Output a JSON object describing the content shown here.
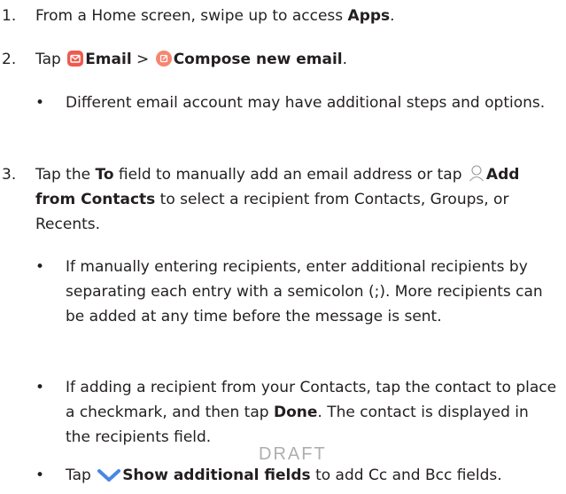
{
  "steps": [
    {
      "number": "1.",
      "pre": "From a Home screen, swipe up to access ",
      "bold": "Apps",
      "post": "."
    },
    {
      "number": "2.",
      "pre": "Tap ",
      "email_label": "Email",
      "separator": " > ",
      "compose_label": "Compose new email",
      "post": ".",
      "bullets": [
        "Different email account may have additional steps and options."
      ]
    },
    {
      "number": "3.",
      "pre": "Tap the ",
      "to_label": "To",
      "mid": " field to manually add an email address or tap ",
      "contacts_label": "Add from Contacts",
      "post": " to select a recipient from Contacts, Groups, or Recents.",
      "bullet1": "If manually entering recipients, enter additional recipients by separating each entry with a semicolon (;). More recipients can be added at any time before the message is sent.",
      "bullet2_pre": "If adding a recipient from your Contacts, tap the contact to place a checkmark, and then tap ",
      "bullet2_bold": "Done",
      "bullet2_post": ". The contact is displayed in the recipients field.",
      "bullet3_pre": "Tap ",
      "bullet3_bold": "Show additional fields",
      "bullet3_post": " to add Cc and Bcc fields."
    }
  ],
  "bullet_char": "•",
  "watermark": "DRAFT",
  "icons": {
    "email_icon": "envelope",
    "compose_icon": "pencil-edit",
    "contacts_icon": "person-outline",
    "expand_icon": "chevron-down"
  },
  "colors": {
    "email_icon_bg": "#ee5a4e",
    "compose_icon_bg": "#f6866f",
    "chevron": "#4b87e4"
  }
}
